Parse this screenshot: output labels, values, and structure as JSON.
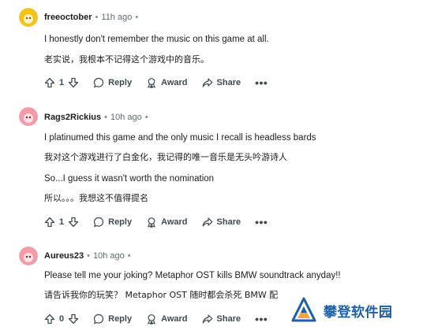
{
  "comments": [
    {
      "author": "freeoctober",
      "time": "11h ago",
      "lines": [
        "I honestly don't remember the music on this game at all.",
        "老实说，我根本不记得这个游戏中的音乐。"
      ],
      "votes": "1",
      "avatar_color": "#f5c21a"
    },
    {
      "author": "Rags2Rickius",
      "time": "10h ago",
      "lines": [
        "I platinumed this game and the only music I recall is headless bards",
        "我对这个游戏进行了白金化，我记得的唯一音乐是无头吟游诗人",
        "So...I guess it wasn't worth the nomination",
        "所以。。。我想这不值得提名"
      ],
      "votes": "1",
      "avatar_color": "#f59aa7"
    },
    {
      "author": "Aureus23",
      "time": "10h ago",
      "lines": [
        "Please tell me your joking? Metaphor OST kills BMW soundtrack anyday!!",
        "请告诉我你的玩笑？ Metaphor OST 随时都会杀死 BMW 配"
      ],
      "votes": "0",
      "avatar_color": "#f59aa7"
    }
  ],
  "actions": {
    "reply": "Reply",
    "award": "Award",
    "share": "Share",
    "more": "•••"
  },
  "meta_separator": "•",
  "watermark": {
    "text": "攀登软件园"
  },
  "colors": {
    "author": "#1c1c1c",
    "meta": "#5c6c74",
    "action": "#3d4a51",
    "watermark": "#1b5fa8"
  }
}
